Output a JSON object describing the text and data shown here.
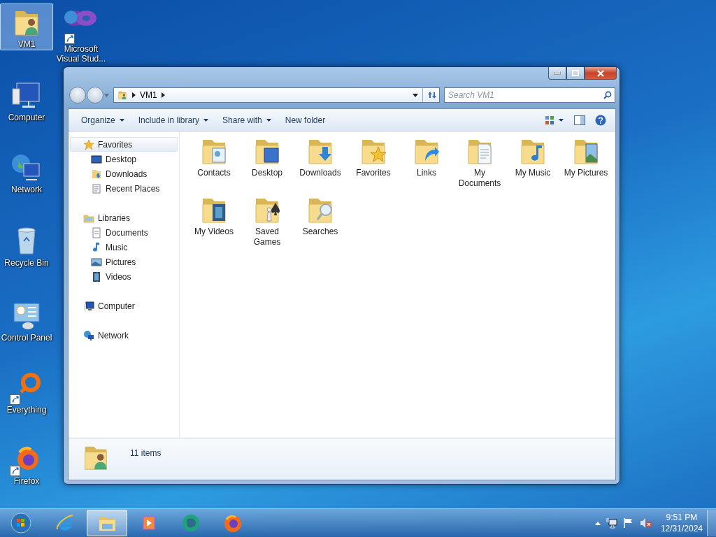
{
  "desktop_icons": [
    {
      "label": "VM1",
      "kind": "user-folder",
      "shortcut": false,
      "selected": true
    },
    {
      "label": "Microsoft Visual Stud...",
      "kind": "infinity",
      "shortcut": true,
      "selected": false
    },
    {
      "label": "Computer",
      "kind": "computer",
      "shortcut": false,
      "selected": false
    },
    {
      "label": "Network",
      "kind": "network",
      "shortcut": false,
      "selected": false
    },
    {
      "label": "Recycle Bin",
      "kind": "recycle-bin",
      "shortcut": false,
      "selected": false
    },
    {
      "label": "Control Panel",
      "kind": "control-panel",
      "shortcut": false,
      "selected": false
    },
    {
      "label": "Everything",
      "kind": "magnifier",
      "shortcut": true,
      "selected": false
    },
    {
      "label": "Firefox",
      "kind": "firefox",
      "shortcut": true,
      "selected": false
    }
  ],
  "window": {
    "breadcrumb": [
      "VM1"
    ],
    "search": {
      "placeholder": "Search VM1"
    },
    "toolbar": [
      {
        "label": "Organize",
        "dropdown": true
      },
      {
        "label": "Include in library",
        "dropdown": true
      },
      {
        "label": "Share with",
        "dropdown": true
      },
      {
        "label": "New folder",
        "dropdown": false
      }
    ],
    "nav": [
      {
        "label": "Favorites",
        "kind": "star",
        "selected": true,
        "children": [
          {
            "label": "Desktop",
            "kind": "desktop",
            "selected": false
          },
          {
            "label": "Downloads",
            "kind": "downloads",
            "selected": false
          },
          {
            "label": "Recent Places",
            "kind": "recent",
            "selected": false
          }
        ]
      },
      {
        "label": "Libraries",
        "kind": "libraries",
        "selected": false,
        "children": [
          {
            "label": "Documents",
            "kind": "documents",
            "selected": false
          },
          {
            "label": "Music",
            "kind": "music",
            "selected": false
          },
          {
            "label": "Pictures",
            "kind": "pictures",
            "selected": false
          },
          {
            "label": "Videos",
            "kind": "videos",
            "selected": false
          }
        ]
      },
      {
        "label": "Computer",
        "kind": "computer",
        "selected": false
      },
      {
        "label": "Network",
        "kind": "network",
        "selected": false
      }
    ],
    "items": [
      {
        "label": "Contacts",
        "kind": "contacts"
      },
      {
        "label": "Desktop",
        "kind": "desktop"
      },
      {
        "label": "Downloads",
        "kind": "downloads"
      },
      {
        "label": "Favorites",
        "kind": "favorites"
      },
      {
        "label": "Links",
        "kind": "links"
      },
      {
        "label": "My Documents",
        "kind": "documents"
      },
      {
        "label": "My Music",
        "kind": "music"
      },
      {
        "label": "My Pictures",
        "kind": "pictures"
      },
      {
        "label": "My Videos",
        "kind": "videos"
      },
      {
        "label": "Saved Games",
        "kind": "games"
      },
      {
        "label": "Searches",
        "kind": "searches"
      }
    ],
    "status": "11 items"
  },
  "taskbar": {
    "buttons": [
      {
        "kind": "start",
        "active": false
      },
      {
        "kind": "ie",
        "active": false
      },
      {
        "kind": "explorer",
        "active": true
      },
      {
        "kind": "media",
        "active": false
      },
      {
        "kind": "green-app",
        "active": false
      },
      {
        "kind": "firefox",
        "active": false
      }
    ],
    "time": "9:51 PM",
    "date": "12/31/2024"
  }
}
